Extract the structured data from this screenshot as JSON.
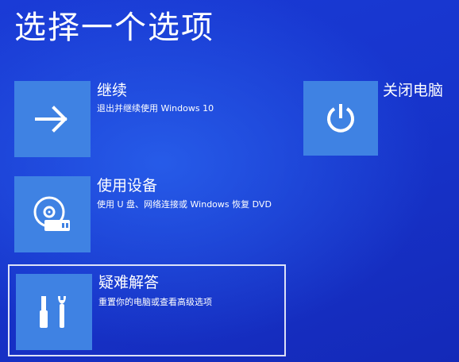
{
  "page": {
    "title": "选择一个选项"
  },
  "options": {
    "continue": {
      "label": "继续",
      "description": "退出并继续使用 Windows 10",
      "icon": "arrow-right-icon"
    },
    "shutdown": {
      "label": "关闭电脑",
      "icon": "power-icon"
    },
    "device": {
      "label": "使用设备",
      "description": "使用 U 盘、网络连接或 Windows 恢复 DVD",
      "icon": "disc-drive-icon"
    },
    "troubleshoot": {
      "label": "疑难解答",
      "description": "重置你的电脑或查看高级选项",
      "icon": "tools-icon"
    }
  },
  "colors": {
    "background": "#1735cd",
    "tile": "#3f82e3",
    "text": "#ffffff"
  }
}
